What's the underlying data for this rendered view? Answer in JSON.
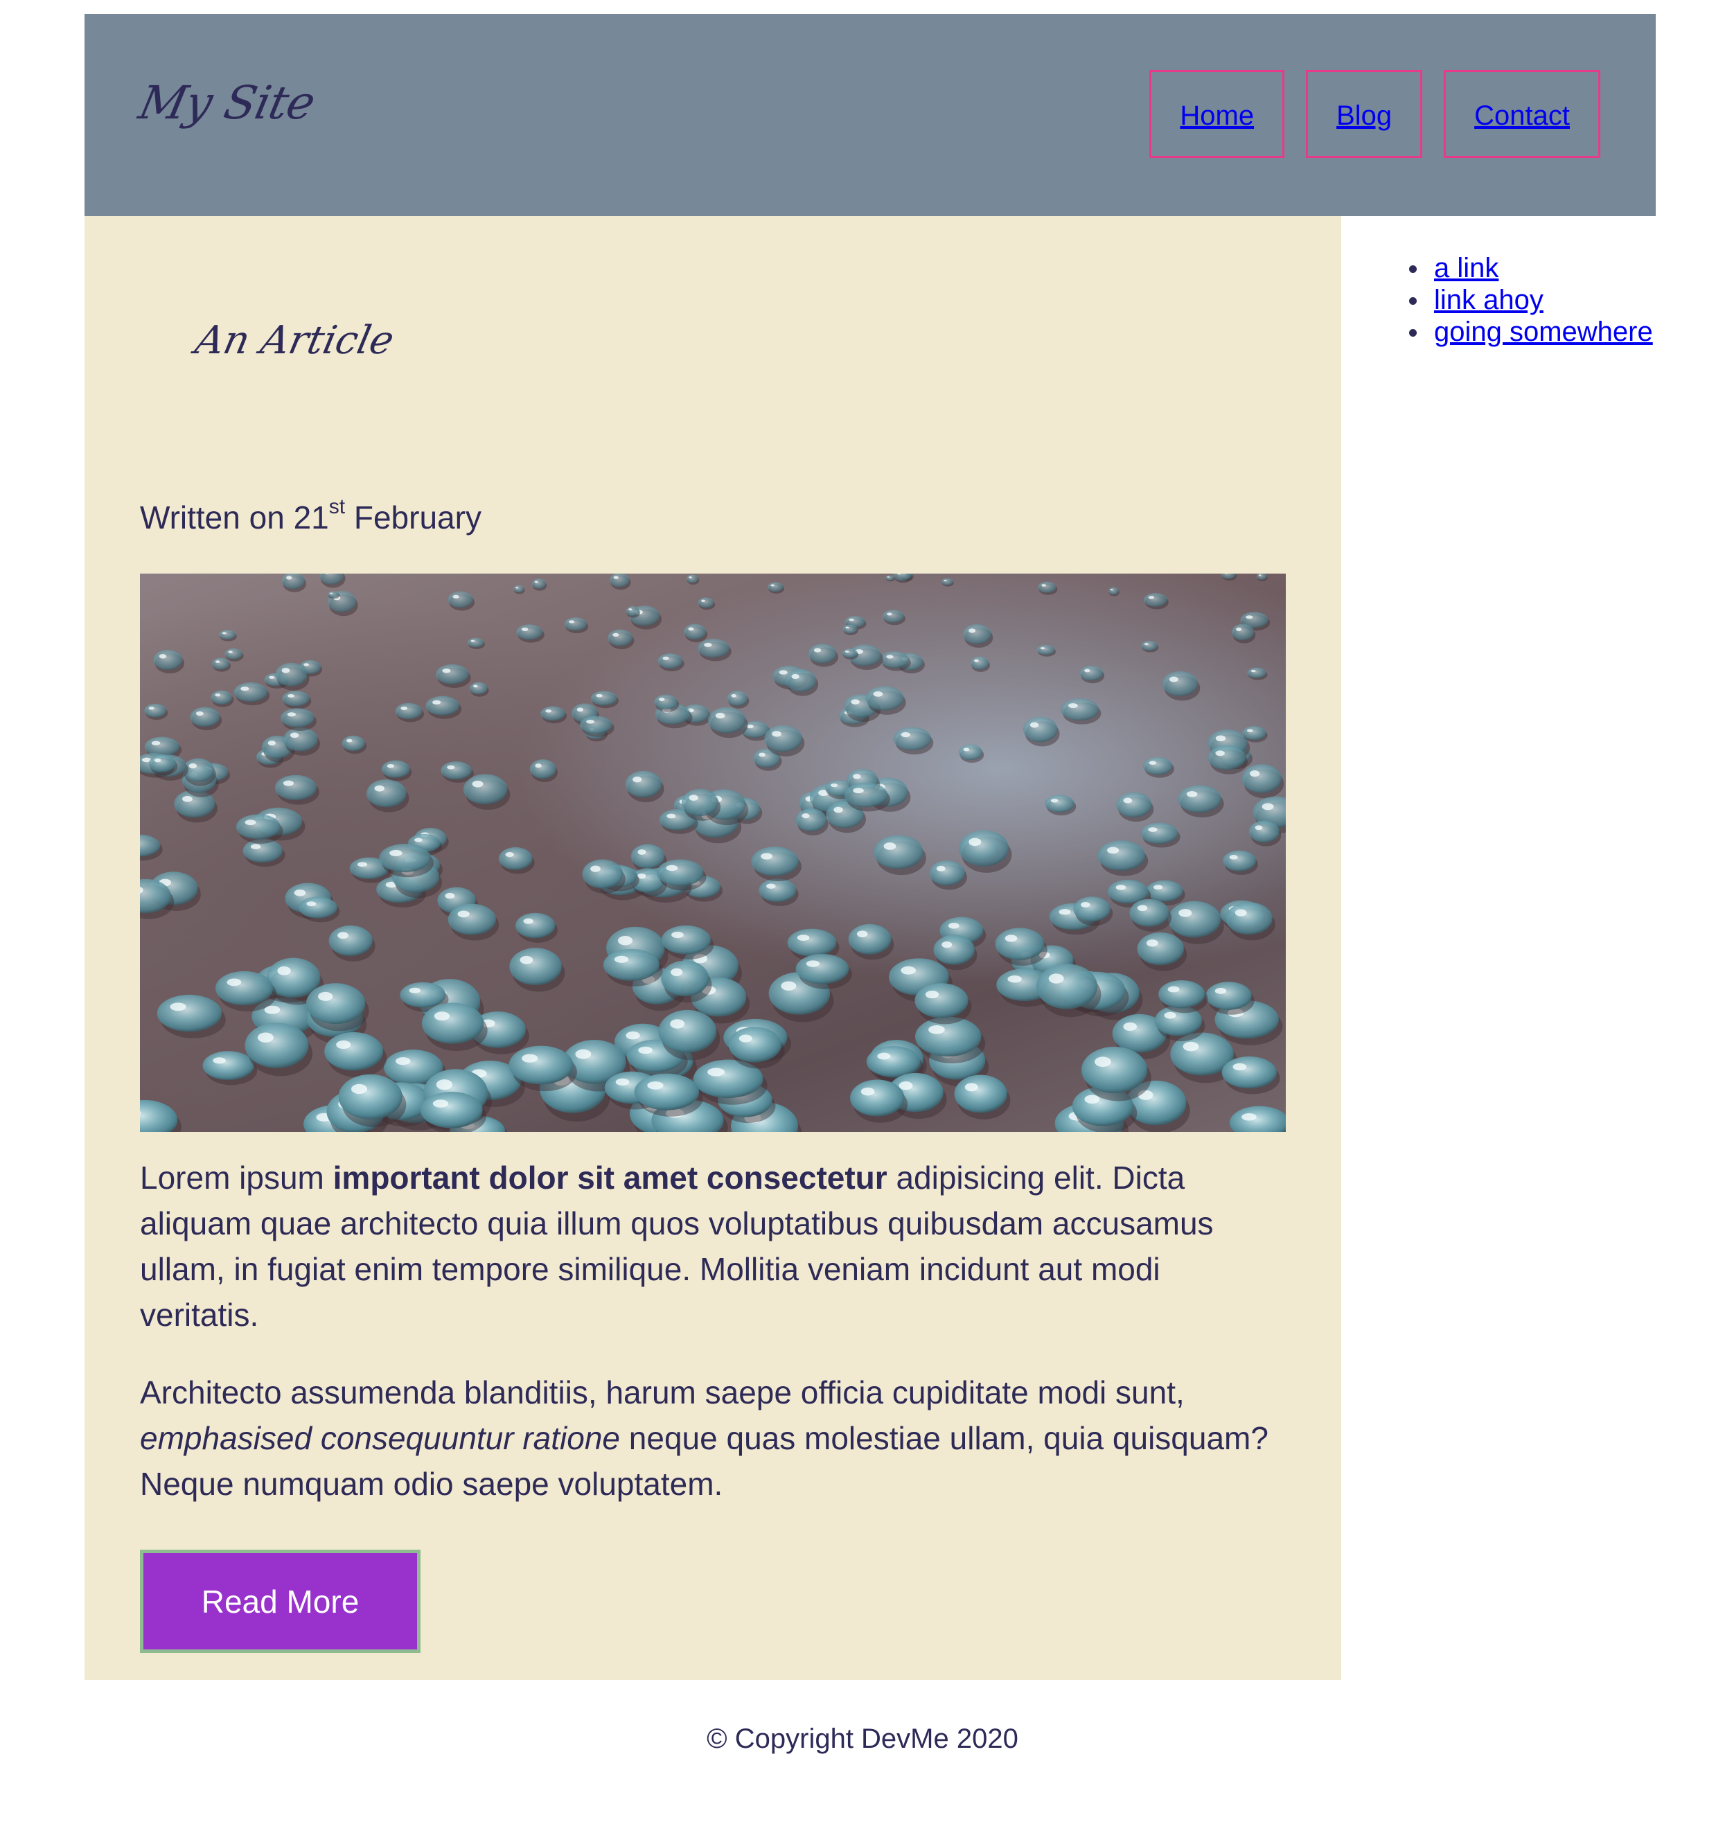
{
  "header": {
    "logo": "My Site",
    "nav": [
      {
        "label": "Home"
      },
      {
        "label": "Blog"
      },
      {
        "label": "Contact"
      }
    ]
  },
  "article": {
    "title": "An Article",
    "written_prefix": "Written on 21",
    "written_sup": "st",
    "written_suffix": " February",
    "image_alt": "water droplets",
    "paragraph1": {
      "start": "Lorem ipsum ",
      "bold": "important dolor sit amet consectetur",
      "end": " adipisicing elit. Dicta aliquam quae architecto quia illum quos voluptatibus quibusdam accusamus ullam, in fugiat enim tempore similique. Mollitia veniam incidunt aut modi veritatis."
    },
    "paragraph2": {
      "start": "Architecto assumenda blanditiis, harum saepe officia cupiditate modi sunt, ",
      "italic": "emphasised consequuntur ratione",
      "end": " neque quas molestiae ullam, quia quisquam? Neque numquam odio saepe voluptatem."
    },
    "read_more_label": "Read More"
  },
  "sidebar": {
    "links": [
      {
        "label": "a link"
      },
      {
        "label": "link ahoy"
      },
      {
        "label": "going somewhere"
      }
    ]
  },
  "footer": {
    "text": "© Copyright DevMe 2020"
  },
  "colors": {
    "header_bg": "#778899",
    "content_bg": "#f1ead0",
    "button_bg": "#9932cc",
    "button_border": "#8fbc8f",
    "nav_border": "#e83a8a",
    "text": "#2e2a57",
    "link": "#0000ee"
  }
}
